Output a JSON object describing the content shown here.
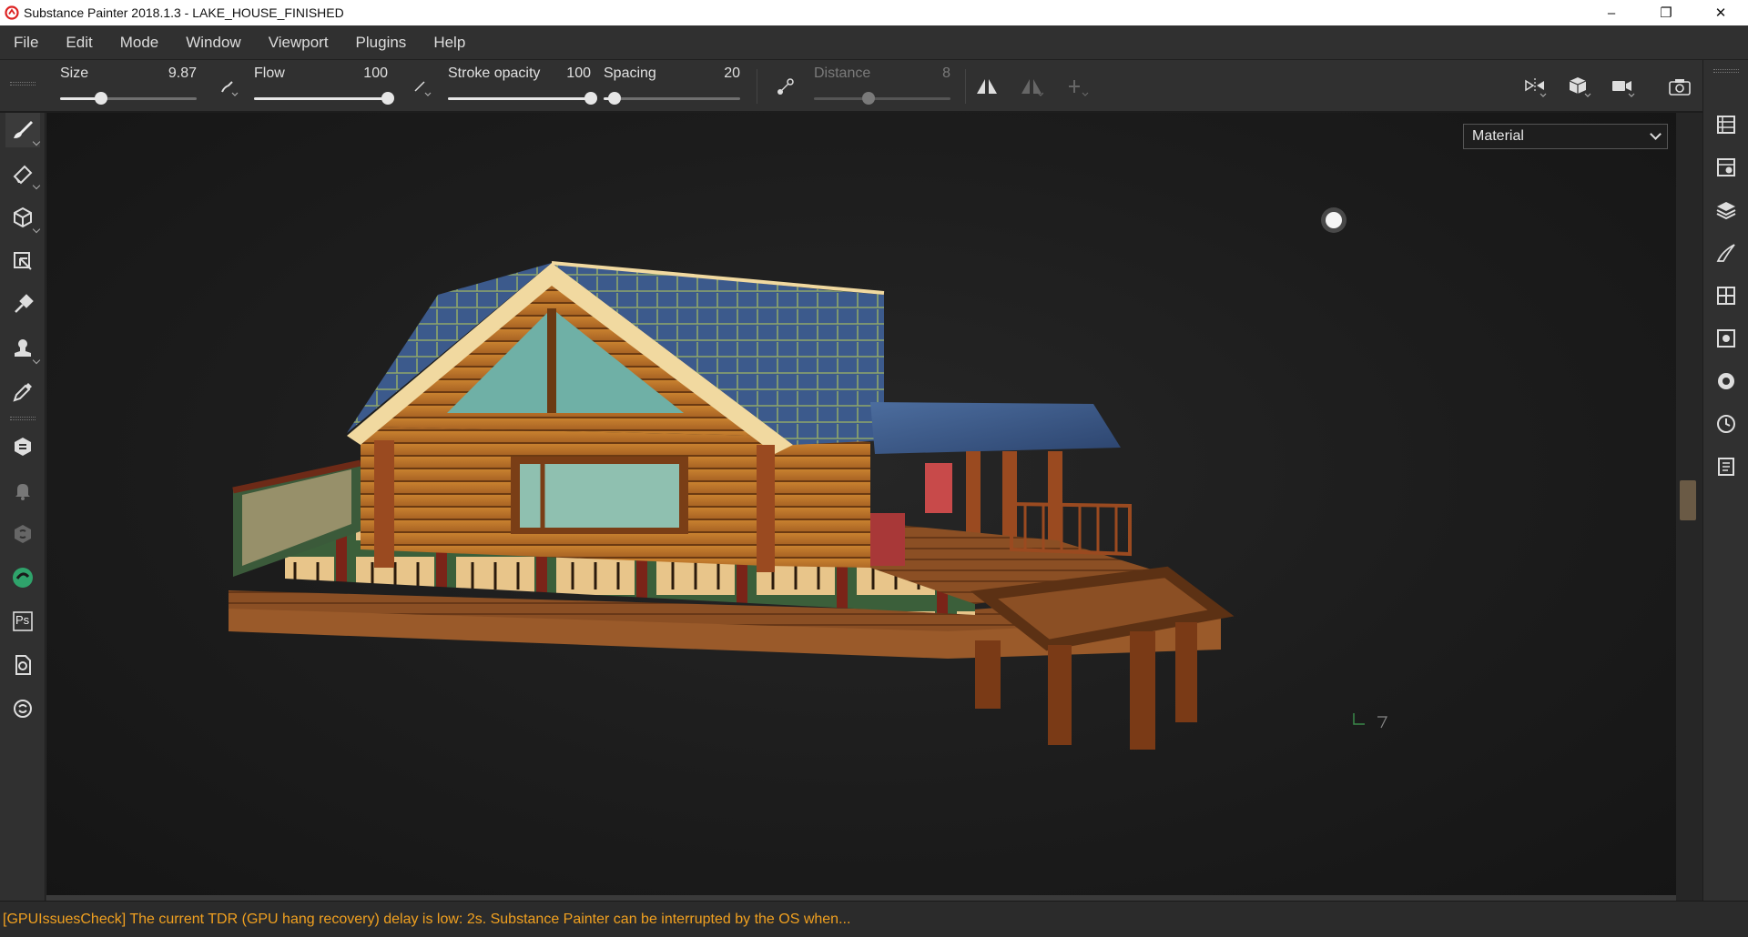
{
  "window": {
    "title": "Substance Painter 2018.1.3 - LAKE_HOUSE_FINISHED",
    "minimize": "–",
    "restore": "❐",
    "close": "✕"
  },
  "menu": [
    "File",
    "Edit",
    "Mode",
    "Window",
    "Viewport",
    "Plugins",
    "Help"
  ],
  "toolbar": {
    "size": {
      "label": "Size",
      "value": "9.87",
      "level": 0.3
    },
    "flow": {
      "label": "Flow",
      "value": "100",
      "level": 1.0
    },
    "stroke_opacity": {
      "label": "Stroke opacity",
      "value": "100",
      "level": 1.0
    },
    "spacing": {
      "label": "Spacing",
      "value": "20",
      "level": 0.08
    },
    "distance": {
      "label": "Distance",
      "value": "8",
      "level": 0.4,
      "disabled": true
    }
  },
  "left_tools": [
    "paint-brush-icon",
    "eraser-icon",
    "projection-icon",
    "polygon-fill-icon",
    "smudge-icon",
    "clone-icon",
    "color-picker-icon",
    "bake-icon",
    "notification-icon",
    "substance-source-icon",
    "share-icon",
    "photoshop-export-icon",
    "sync-icon",
    "substance-icon"
  ],
  "photoshop_label": "Ps",
  "right_tools": [
    "layers-stack-icon",
    "texture-set-settings-icon",
    "layers-icon",
    "history-brush-icon",
    "display-settings-icon",
    "shelf-settings-icon",
    "viewer-settings-icon",
    "history-icon",
    "log-icon"
  ],
  "viewport": {
    "channel_select": "Material"
  },
  "status": "[GPUIssuesCheck] The current TDR (GPU hang recovery) delay is low: 2s. Substance Painter can be interrupted by the OS when..."
}
